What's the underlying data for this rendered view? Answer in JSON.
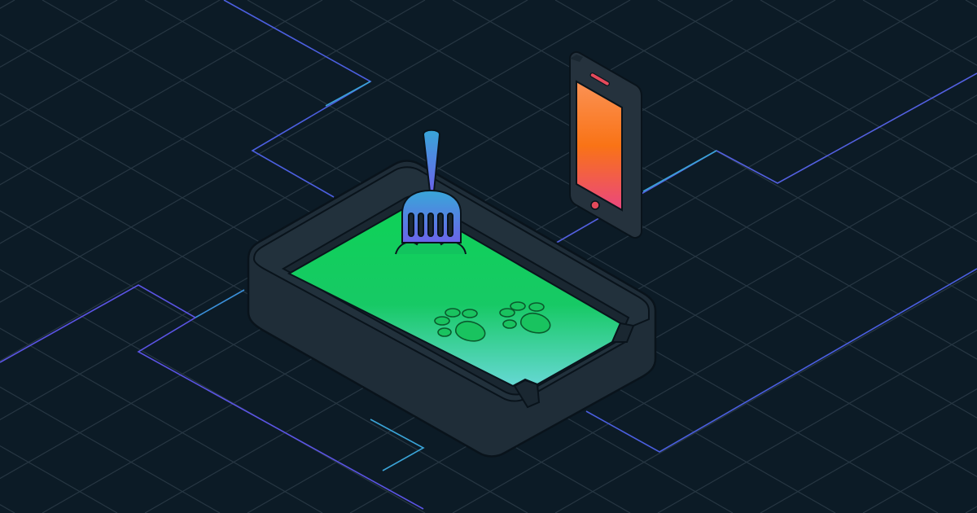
{
  "scene": {
    "background": "#0c1b26",
    "grid_color": "#2b3b47",
    "circuit_colors": [
      "#6c5ce7",
      "#4b6fe0",
      "#3aa3d6"
    ],
    "litter_box": {
      "shell_color": "#1f2d38",
      "outline_color": "#0a141c",
      "litter_gradient": [
        "#0fcf5a",
        "#18c267",
        "#5fd7cc"
      ]
    },
    "paw_prints": {
      "count": 2,
      "color": "#1ac562"
    },
    "scoop": {
      "gradient": [
        "#3aa3d6",
        "#6d6be8"
      ],
      "icon": "litter-scoop-icon"
    },
    "phone": {
      "body_color": "#25323d",
      "screen_gradient": [
        "#fd8a4b",
        "#f97316",
        "#e9497d"
      ],
      "icon": "smartphone-icon"
    }
  }
}
